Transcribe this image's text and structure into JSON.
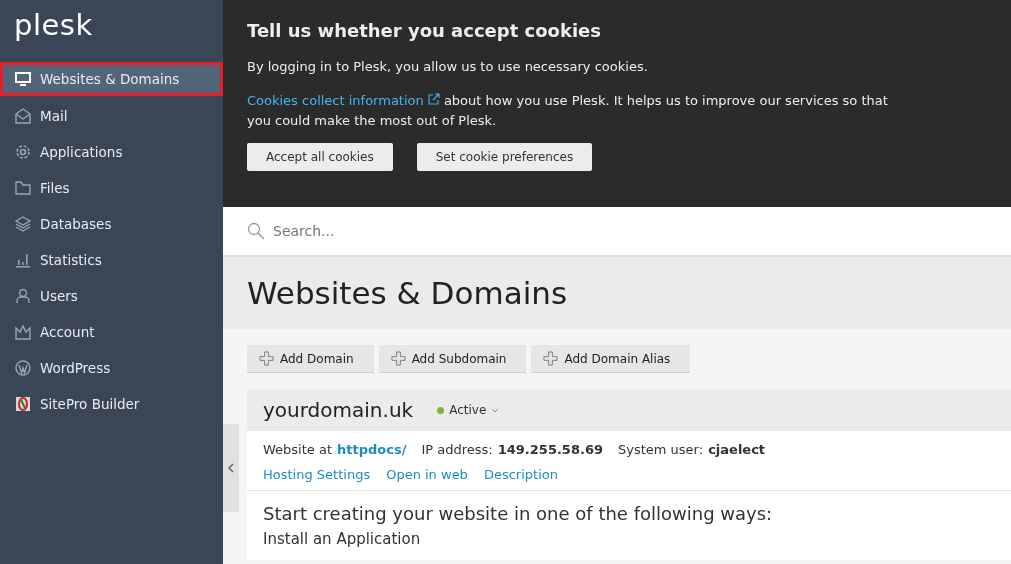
{
  "logo": "plesk",
  "sidebar": {
    "items": [
      {
        "label": "Websites & Domains",
        "selected": true
      },
      {
        "label": "Mail",
        "selected": false
      },
      {
        "label": "Applications",
        "selected": false
      },
      {
        "label": "Files",
        "selected": false
      },
      {
        "label": "Databases",
        "selected": false
      },
      {
        "label": "Statistics",
        "selected": false
      },
      {
        "label": "Users",
        "selected": false
      },
      {
        "label": "Account",
        "selected": false
      },
      {
        "label": "WordPress",
        "selected": false
      },
      {
        "label": "SitePro Builder",
        "selected": false
      }
    ]
  },
  "cookie_banner": {
    "title": "Tell us whether you accept cookies",
    "text": "By logging in to Plesk, you allow us to use necessary cookies.",
    "link": "Cookies collect information",
    "link_text": "about how you use Plesk. It helps us to improve our services so that you could make the most out of Plesk.",
    "buttons": [
      "Accept all cookies",
      "Set cookie preferences"
    ]
  },
  "search": {
    "placeholder": "Search..."
  },
  "page_title": "Websites & Domains",
  "toolbar": [
    "Add Domain",
    "Add Subdomain",
    "Add Domain Alias"
  ],
  "domain": {
    "name": "yourdomain.uk",
    "status": {
      "label": "Active",
      "color": "#7cb342"
    },
    "website_label": "Website at",
    "website_link": "httpdocs/",
    "ip_label": "IP address:",
    "ip": "149.255.58.69",
    "user_label": "System user:",
    "user": "cjaelect",
    "links": [
      "Hosting Settings",
      "Open in web",
      "Description"
    ],
    "heading": "Start creating your website in one of the following ways:",
    "subheading": "Install an Application"
  }
}
